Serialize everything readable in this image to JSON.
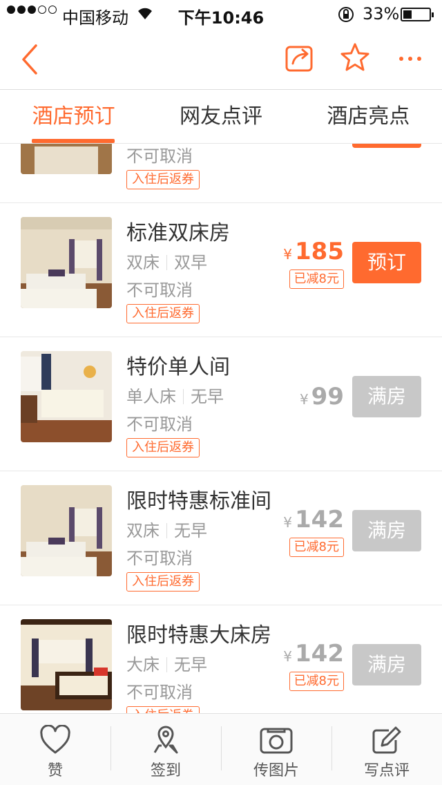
{
  "status_bar": {
    "carrier": "中国移动",
    "time": "下午10:46",
    "battery": "33%",
    "battery_level": 0.33
  },
  "nav": {
    "icons": [
      "back-icon",
      "share-icon",
      "star-icon",
      "more-icon"
    ],
    "accent": "#ff6a2f"
  },
  "tabs": [
    {
      "label": "酒店预订",
      "active": true
    },
    {
      "label": "网友点评",
      "active": false
    },
    {
      "label": "酒店亮点",
      "active": false
    }
  ],
  "rooms": [
    {
      "name": "",
      "bed": "",
      "breakfast": "",
      "cancel": "不可取消",
      "voucher": "入住后返券",
      "price": "",
      "discount": "",
      "button": ""
    },
    {
      "name": "标准双床房",
      "bed": "双床",
      "breakfast": "双早",
      "cancel": "不可取消",
      "voucher": "入住后返券",
      "currency": "¥",
      "price": "185",
      "discount": "已减8元",
      "button": "预订"
    },
    {
      "name": "特价单人间",
      "bed": "单人床",
      "breakfast": "无早",
      "cancel": "不可取消",
      "voucher": "入住后返券",
      "currency": "¥",
      "price": "99",
      "discount": "",
      "button": "满房"
    },
    {
      "name": "限时特惠标准间",
      "bed": "双床",
      "breakfast": "无早",
      "cancel": "不可取消",
      "voucher": "入住后返券",
      "currency": "¥",
      "price": "142",
      "discount": "已减8元",
      "button": "满房"
    },
    {
      "name": "限时特惠大床房",
      "bed": "大床",
      "breakfast": "无早",
      "cancel": "不可取消",
      "voucher": "入住后返券",
      "currency": "¥",
      "price": "142",
      "discount": "已减8元",
      "button": "满房"
    }
  ],
  "bottom_bar": [
    {
      "label": "赞",
      "icon": "heart-icon"
    },
    {
      "label": "签到",
      "icon": "location-pin-icon"
    },
    {
      "label": "传图片",
      "icon": "camera-icon"
    },
    {
      "label": "写点评",
      "icon": "edit-icon"
    }
  ]
}
